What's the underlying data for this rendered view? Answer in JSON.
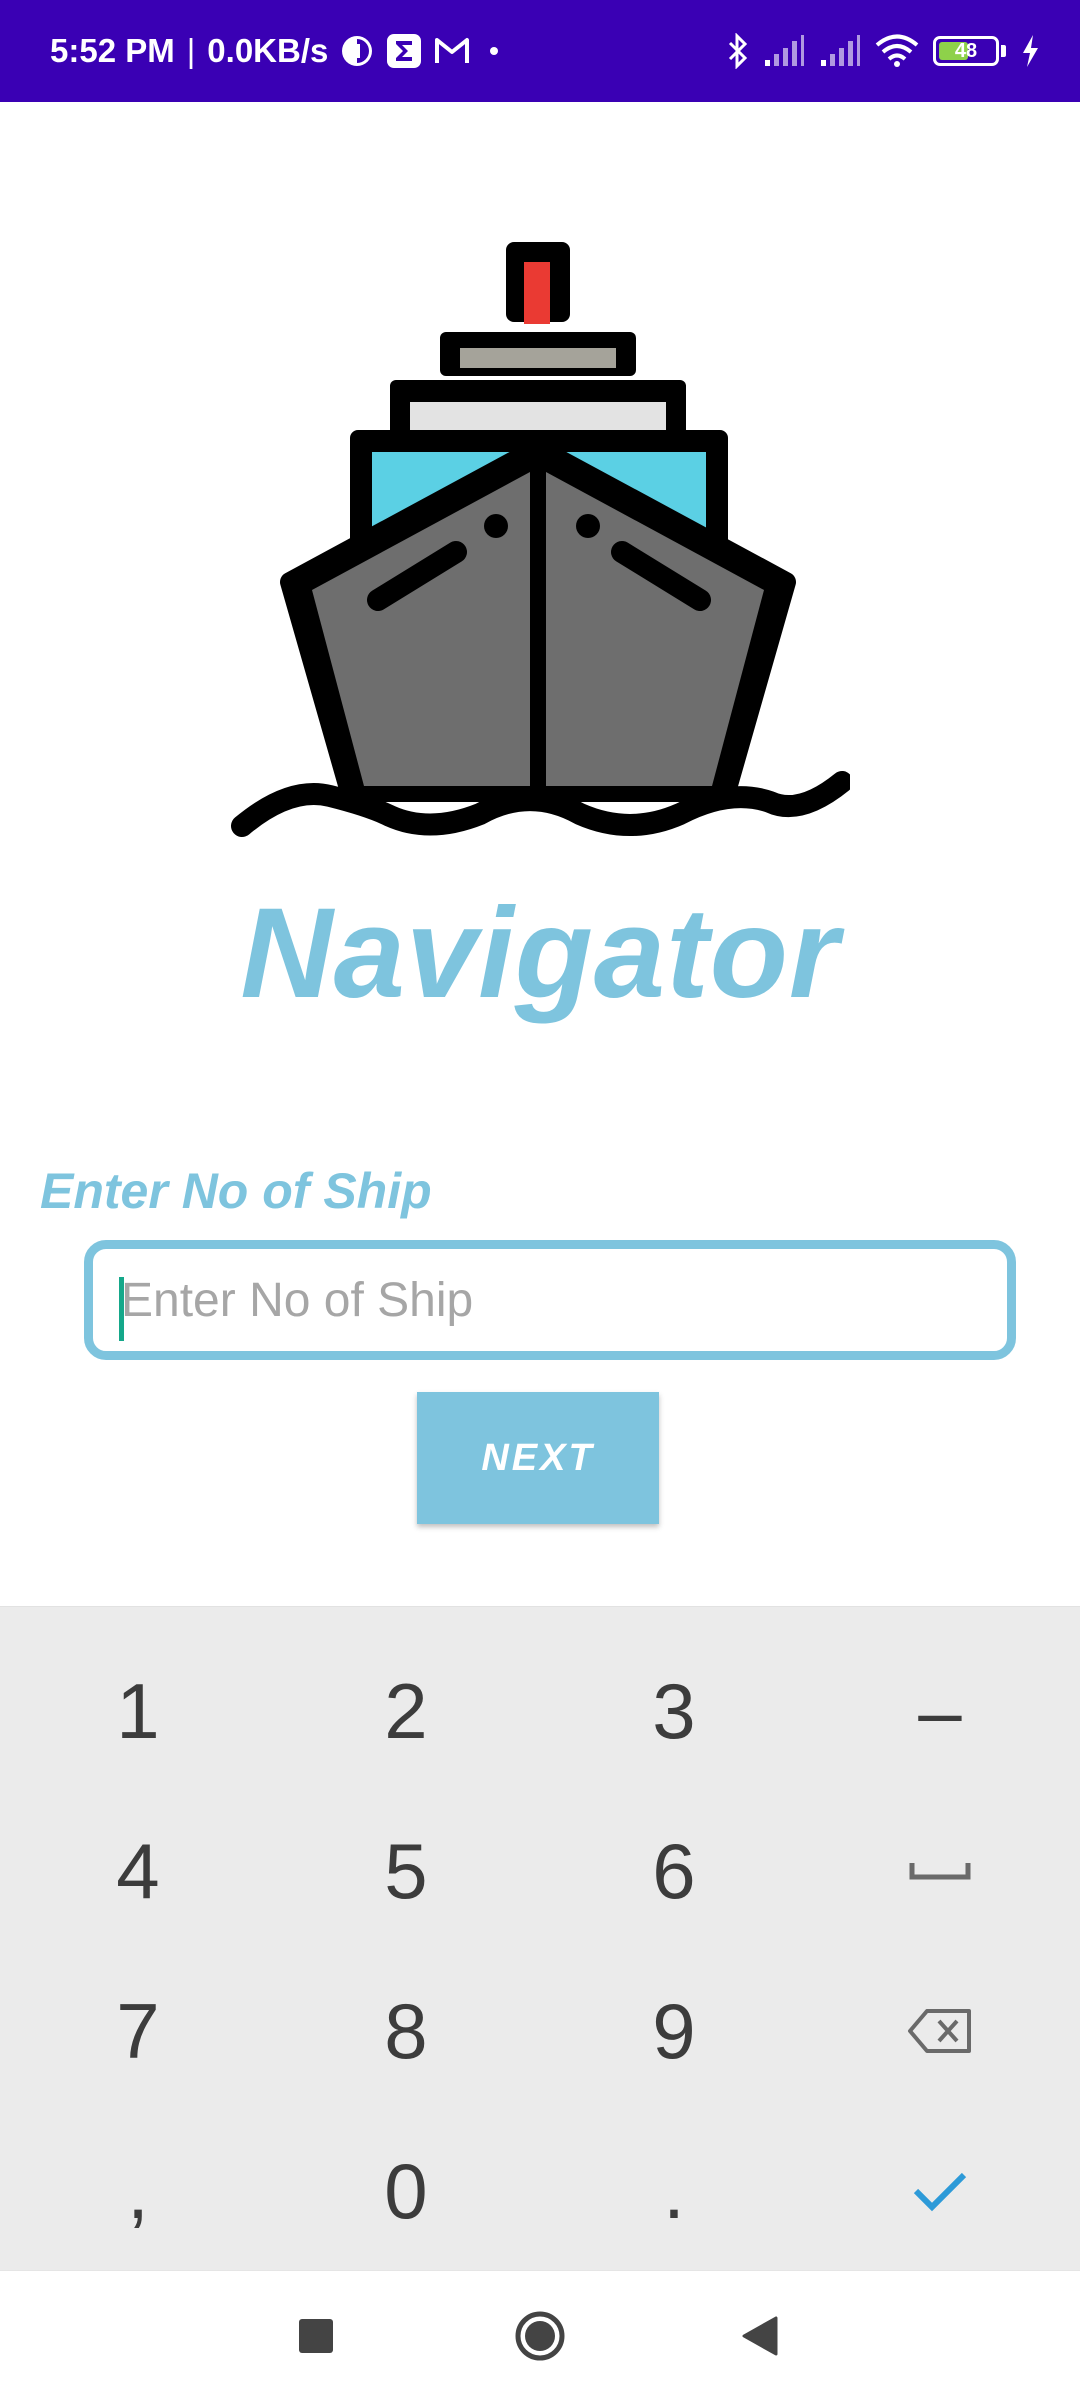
{
  "status_bar": {
    "time": "5:52 PM",
    "separator": "|",
    "network_speed": "0.0KB/s",
    "battery_level": "48",
    "icons_left": [
      "vpn-icon",
      "sigma-app-icon",
      "gmail-icon",
      "dot-icon"
    ],
    "icons_right": [
      "bluetooth-icon",
      "signal-icon",
      "signal-icon",
      "wifi-icon",
      "battery-icon",
      "charging-icon"
    ],
    "color": "#3a00b4"
  },
  "app": {
    "title": "Navigator",
    "accent_color": "#7ec4de",
    "logo_icon": "ship-icon"
  },
  "form": {
    "label": "Enter No of Ship",
    "input_placeholder": "Enter No of Ship",
    "input_value": "",
    "next_label": "NEXT"
  },
  "keyboard": {
    "rows": [
      [
        "1",
        "2",
        "3",
        "–"
      ],
      [
        "4",
        "5",
        "6",
        "space"
      ],
      [
        "7",
        "8",
        "9",
        "backspace"
      ],
      [
        ",",
        "0",
        ".",
        "done"
      ]
    ]
  },
  "nav_bar": {
    "buttons": [
      "recents-icon",
      "home-icon",
      "back-icon"
    ]
  }
}
